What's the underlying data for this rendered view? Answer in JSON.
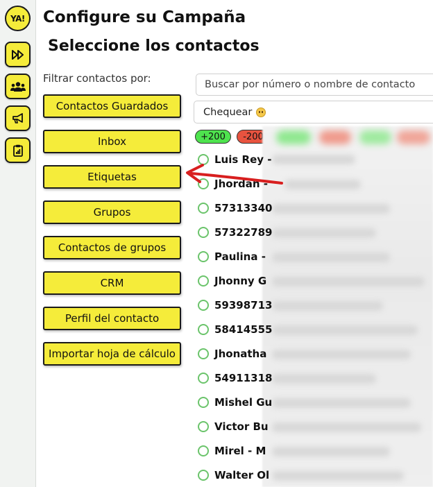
{
  "sidebar": {
    "logo_text": "YA!",
    "items": [
      {
        "icon": "fast-forward-icon"
      },
      {
        "icon": "users-icon"
      },
      {
        "icon": "megaphone-icon"
      },
      {
        "icon": "clipboard-icon"
      }
    ]
  },
  "header": {
    "title": "Configure su Campaña",
    "subtitle": "Seleccione los contactos"
  },
  "filters": {
    "label": "Filtrar contactos por:",
    "buttons": [
      "Contactos Guardados",
      "Inbox",
      "Etiquetas",
      "Grupos",
      "Contactos de grupos",
      "CRM",
      "Perfil del contacto",
      "Importar hoja de cálculo"
    ]
  },
  "search": {
    "placeholder": "Buscar por número o nombre de contacto"
  },
  "check": {
    "label": "Chequear"
  },
  "pills": {
    "plus": "+200",
    "minus": "-200"
  },
  "contacts": [
    "Luis Rey -",
    "Jhordan -",
    "57313340",
    "57322789",
    "Paulina -",
    "Jhonny G",
    "59398713",
    "58414555",
    "Jhonatha",
    "54911318",
    "Mishel Gu",
    "Victor Bu",
    "Mirel - M",
    "Walter Ol"
  ],
  "colors": {
    "accent": "#f5ec3a",
    "green": "#4ee34e",
    "red": "#e8533f",
    "annotation": "#d81f1f"
  }
}
